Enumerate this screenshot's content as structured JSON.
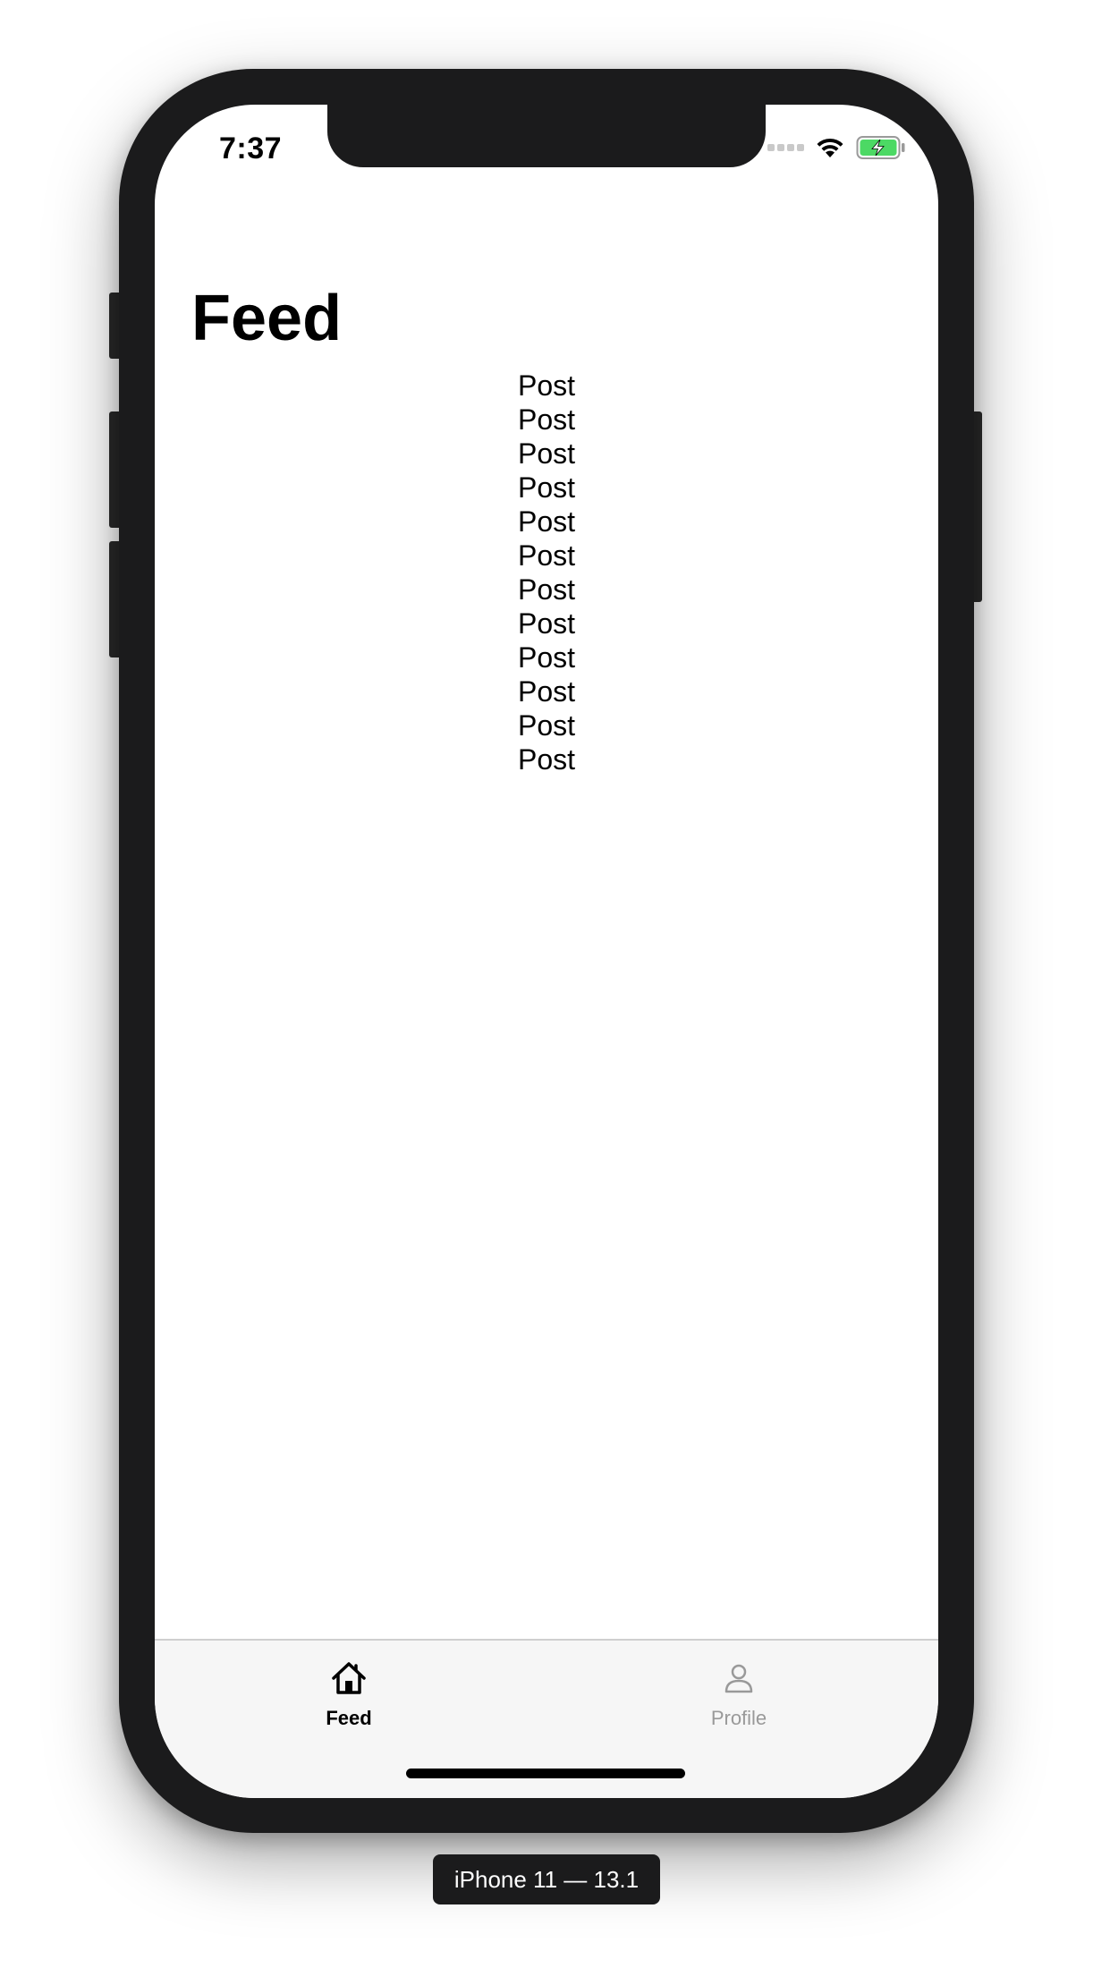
{
  "status_bar": {
    "time": "7:37",
    "icons": [
      "cellular-signal-icon",
      "wifi-icon",
      "battery-charging-icon"
    ]
  },
  "navigation": {
    "title": "Feed"
  },
  "posts": [
    "Post",
    "Post",
    "Post",
    "Post",
    "Post",
    "Post",
    "Post",
    "Post",
    "Post",
    "Post",
    "Post",
    "Post"
  ],
  "tab_bar": {
    "items": [
      {
        "label": "Feed",
        "icon": "home-icon",
        "selected": true
      },
      {
        "label": "Profile",
        "icon": "person-icon",
        "selected": false
      }
    ]
  },
  "simulator": {
    "device_label": "iPhone 11 — 13.1"
  },
  "colors": {
    "battery_fill": "#4cd964",
    "tab_selected": "#000000",
    "tab_unselected": "#999999",
    "tabbar_background": "#f6f6f6"
  }
}
